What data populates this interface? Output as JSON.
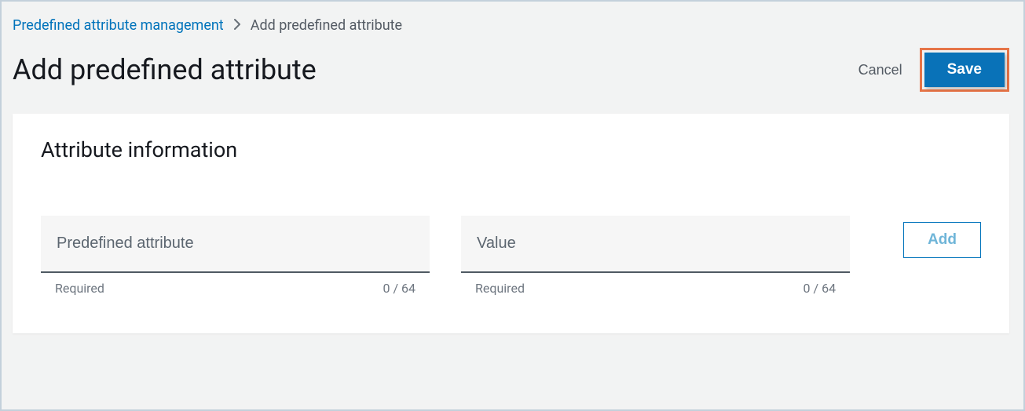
{
  "breadcrumb": {
    "parent": "Predefined attribute management",
    "current": "Add predefined attribute"
  },
  "header": {
    "title": "Add predefined attribute",
    "cancel_label": "Cancel",
    "save_label": "Save"
  },
  "panel": {
    "title": "Attribute information",
    "fields": {
      "attribute": {
        "placeholder": "Predefined attribute",
        "required_label": "Required",
        "counter": "0 / 64"
      },
      "value": {
        "placeholder": "Value",
        "required_label": "Required",
        "counter": "0 / 64"
      }
    },
    "add_label": "Add"
  }
}
